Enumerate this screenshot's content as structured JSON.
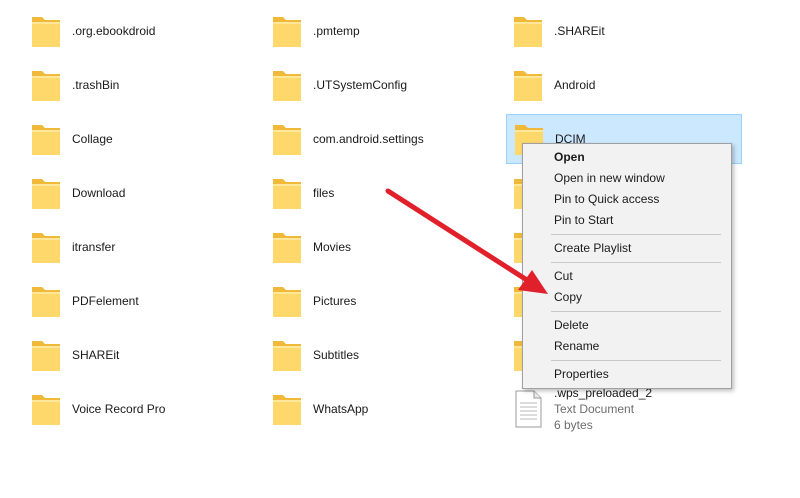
{
  "items": [
    {
      "label": ".org.ebookdroid",
      "type": "folder"
    },
    {
      "label": ".pmtemp",
      "type": "folder"
    },
    {
      "label": ".SHAREit",
      "type": "folder"
    },
    {
      "label": ".trashBin",
      "type": "folder"
    },
    {
      "label": ".UTSystemConfig",
      "type": "folder"
    },
    {
      "label": "Android",
      "type": "folder"
    },
    {
      "label": "Collage",
      "type": "folder"
    },
    {
      "label": "com.android.settings",
      "type": "folder"
    },
    {
      "label": "DCIM",
      "type": "folder",
      "selected": true
    },
    {
      "label": "Download",
      "type": "folder"
    },
    {
      "label": "files",
      "type": "folder"
    },
    {
      "label": "",
      "type": "folder"
    },
    {
      "label": "itransfer",
      "type": "folder"
    },
    {
      "label": "Movies",
      "type": "folder"
    },
    {
      "label": "",
      "type": "folder"
    },
    {
      "label": "PDFelement",
      "type": "folder"
    },
    {
      "label": "Pictures",
      "type": "folder"
    },
    {
      "label": "",
      "type": "folder"
    },
    {
      "label": "SHAREit",
      "type": "folder"
    },
    {
      "label": "Subtitles",
      "type": "folder"
    },
    {
      "label": "",
      "type": "folder"
    },
    {
      "label": "Voice Record Pro",
      "type": "folder"
    },
    {
      "label": "WhatsApp",
      "type": "folder"
    },
    {
      "label": ".wps_preloaded_2",
      "type": "file",
      "kind": "Text Document",
      "size": "6 bytes"
    }
  ],
  "context_menu": {
    "items": [
      {
        "label": "Open",
        "bold": true
      },
      {
        "label": "Open in new window"
      },
      {
        "label": "Pin to Quick access"
      },
      {
        "label": "Pin to Start"
      },
      {
        "separator": true
      },
      {
        "label": "Create Playlist"
      },
      {
        "separator": true
      },
      {
        "label": "Cut"
      },
      {
        "label": "Copy"
      },
      {
        "separator": true
      },
      {
        "label": "Delete"
      },
      {
        "label": "Rename"
      },
      {
        "separator": true
      },
      {
        "label": "Properties"
      }
    ]
  },
  "colors": {
    "folder_body": "#ffd86b",
    "folder_back": "#f0b93a",
    "selection_bg": "#cce8ff",
    "selection_border": "#99d1ff",
    "annotation_arrow": "#e0202a"
  }
}
